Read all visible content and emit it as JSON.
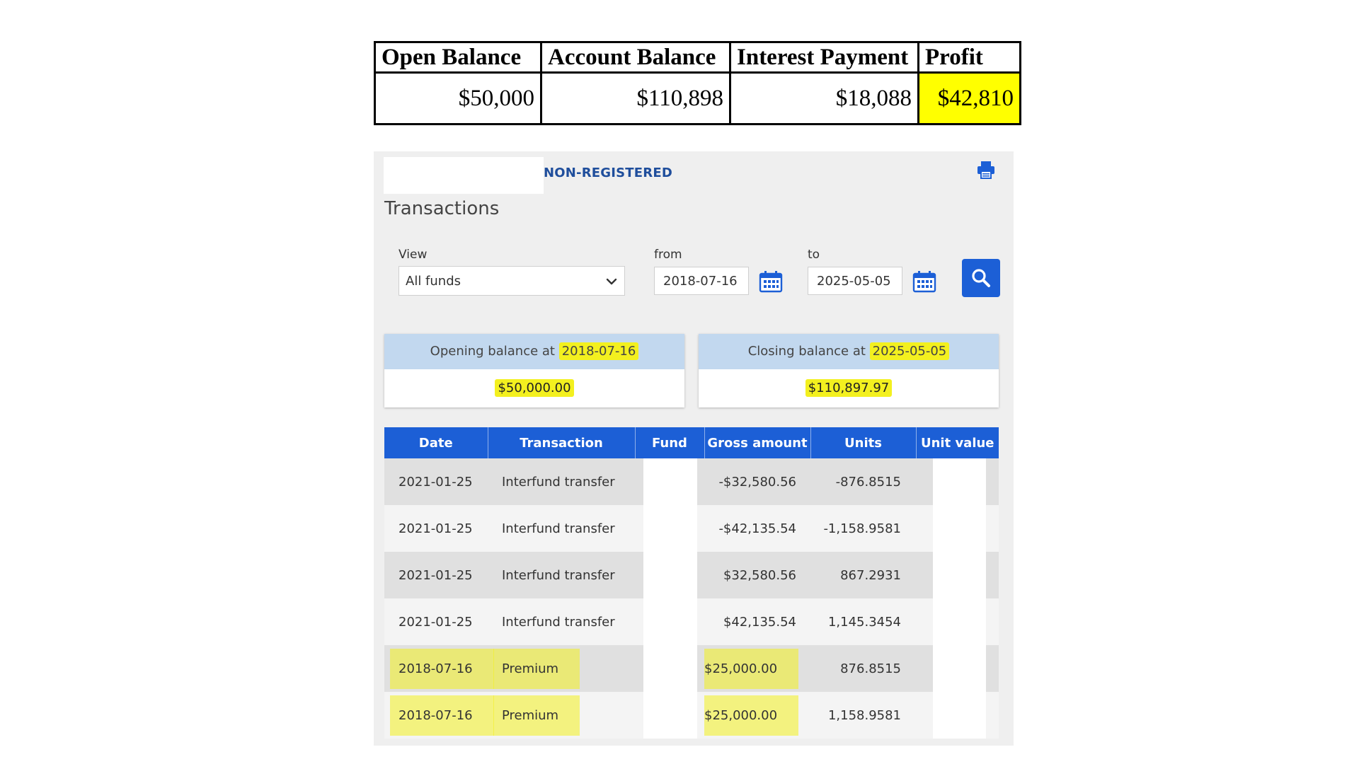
{
  "summary": {
    "headers": [
      "Open Balance",
      "Account Balance",
      "Interest Payment",
      "Profit"
    ],
    "values": [
      "$50,000",
      "$110,898",
      "$18,088",
      "$42,810"
    ],
    "highlight_color": "#ffff00"
  },
  "panel": {
    "account_type": "NON-REGISTERED",
    "title": "Transactions",
    "print_icon": "printer-icon"
  },
  "filters": {
    "view_label": "View",
    "view_value": "All funds",
    "from_label": "from",
    "from_value": "2018-07-16",
    "to_label": "to",
    "to_value": "2025-05-05",
    "calendar_icon": "calendar-icon",
    "search_icon": "search-icon"
  },
  "balances": {
    "opening_label": "Opening balance at",
    "opening_date": "2018-07-16",
    "opening_amount": "$50,000.00",
    "closing_label": "Closing balance at",
    "closing_date": "2025-05-05",
    "closing_amount": "$110,897.97",
    "highlight_color": "#f3f01f"
  },
  "table": {
    "headers": [
      "Date",
      "Transaction",
      "Fund",
      "Gross amount",
      "Units",
      "Unit value"
    ],
    "header_color": "#1c5fd6",
    "rows": [
      {
        "date": "2021-01-25",
        "transaction": "Interfund transfer",
        "gross": "-$32,580.56",
        "units": "-876.8515"
      },
      {
        "date": "2021-01-25",
        "transaction": "Interfund transfer",
        "gross": "-$42,135.54",
        "units": "-1,158.9581"
      },
      {
        "date": "2021-01-25",
        "transaction": "Interfund transfer",
        "gross": "$32,580.56",
        "units": "867.2931"
      },
      {
        "date": "2021-01-25",
        "transaction": "Interfund transfer",
        "gross": "$42,135.54",
        "units": "1,145.3454"
      },
      {
        "date": "2018-07-16",
        "transaction": "Premium",
        "gross": "$25,000.00",
        "units": "876.8515"
      },
      {
        "date": "2018-07-16",
        "transaction": "Premium",
        "gross": "$25,000.00",
        "units": "1,158.9581"
      }
    ]
  }
}
